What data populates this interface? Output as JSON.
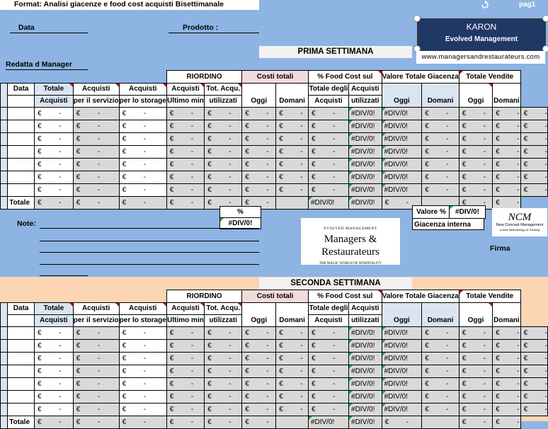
{
  "header": {
    "format_title": "Format: Analisi giacenze e food cost acquisti  Bisettimanale",
    "page_label": "pag1",
    "data_label": "Data",
    "prodotto_label": "Prodotto :",
    "redatta_label": "Redatta d Manager"
  },
  "brand": {
    "karon_name": "KARON",
    "karon_sub": "Evolved Management",
    "website": "www.managersandrestaurateurs.com",
    "logo_top": "EVOLVED MANAGEMENT",
    "logo_main": "Managers & Restaurateurs",
    "logo_tagline": "THE MAGIC WORLD OF HOSPITALITY",
    "ncm_mark": "NCM",
    "ncm_name": "New Concept Management",
    "ncm_tagline": "A New Methodology of Thinking"
  },
  "columns": {
    "riordino": "RIORDINO",
    "costi_totali": "Costi totali",
    "food_cost": "% Food Cost  sul",
    "valore_giacenza": "Valore Totale Giacenza",
    "totale_vendite": "Totale Vendite",
    "data": "Data",
    "totale": "Totale",
    "acquisti": "Acquisti",
    "per_servizio": "per il servizio",
    "per_storage": "per lo storage",
    "ultimo_min": "Ultimo min",
    "tot_acqu": "Tot. Acqu.",
    "utilizzati": "utilizzati",
    "oggi": "Oggi",
    "domani": "Domani",
    "totale_degli": "Totale degli"
  },
  "cells": {
    "euro": "€",
    "dash": "-",
    "div0": "#DIV/0!",
    "totale_row": "Totale"
  },
  "weeks": [
    {
      "title": "PRIMA SETTIMANA"
    },
    {
      "title": "SECONDA SETTIMANA"
    }
  ],
  "summary": {
    "percent_label": "%",
    "percent_value": "#DIV/0!",
    "valore_label": "Valore %",
    "valore_value": "#DIV/0!",
    "giacenza_label": "Giacenza interna",
    "note_label": "Note:",
    "firma_label": "Firma"
  },
  "colors": {
    "background": "#8db4e2",
    "peach": "#fcd5b4",
    "karon_bg": "#1f3864",
    "cell_grey": "#d9d9d9",
    "header_blue": "#dbe5f1",
    "header_pink": "#f2dcdb"
  }
}
